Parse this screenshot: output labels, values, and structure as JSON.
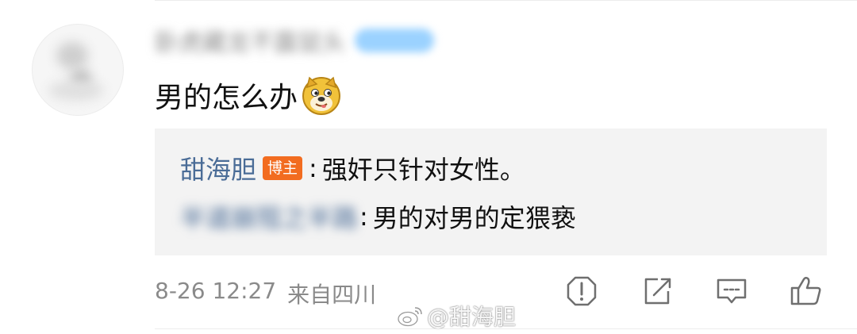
{
  "comment": {
    "username_blurred": "卧虎藏龙不露鼠头",
    "text": "男的怎么办",
    "emoji": "doge-icon",
    "time": "8-26 12:27",
    "location": "来自四川"
  },
  "replies": [
    {
      "name": "甜海胆",
      "badge": "博主",
      "separator": ":",
      "content": "强奸只针对女性。"
    },
    {
      "name_blurred": "半道崩殂之半路",
      "separator": ":",
      "content": "男的对男的定猥亵"
    }
  ],
  "actions": [
    "report-icon",
    "share-icon",
    "comment-icon",
    "like-icon"
  ],
  "watermark": {
    "text": "@甜海胆",
    "icon": "weibo-logo-icon"
  },
  "colors": {
    "link_blue": "#4a6c97",
    "badge_orange": "#f26c20",
    "reply_bg": "#f3f3f3",
    "meta_gray": "#8a8a8a"
  }
}
